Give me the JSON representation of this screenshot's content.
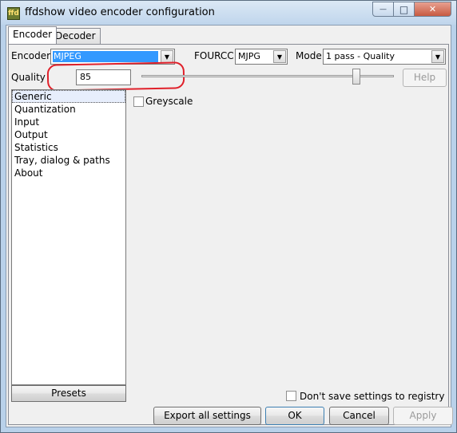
{
  "window": {
    "title": "ffdshow video encoder configuration",
    "icon_text": "ffd",
    "minimize_glyph": "—",
    "maximize_glyph": "□",
    "close_glyph": "✕"
  },
  "tabs": [
    {
      "label": "Encoder",
      "active": true
    },
    {
      "label": "Decoder",
      "active": false
    }
  ],
  "encoder_row": {
    "encoder_label": "Encoder:",
    "encoder_value": "MJPEG",
    "fourcc_label": "FOURCC:",
    "fourcc_value": "MJPG",
    "mode_label": "Mode:",
    "mode_value": "1 pass - Quality"
  },
  "quality_row": {
    "label": "Quality",
    "value": "85",
    "slider_level": 0.85,
    "help_label": "Help"
  },
  "sections": [
    {
      "label": "Generic",
      "selected": true
    },
    {
      "label": "Quantization",
      "selected": false
    },
    {
      "label": "Input",
      "selected": false
    },
    {
      "label": "Output",
      "selected": false
    },
    {
      "label": "Statistics",
      "selected": false
    },
    {
      "label": "Tray, dialog & paths",
      "selected": false
    },
    {
      "label": "About",
      "selected": false
    }
  ],
  "generic_page": {
    "greyscale_label": "Greyscale",
    "greyscale_checked": false
  },
  "presets_label": "Presets",
  "dont_save": {
    "label": "Don't save settings to registry",
    "checked": false
  },
  "footer": {
    "export_label": "Export all settings",
    "ok_label": "OK",
    "cancel_label": "Cancel",
    "apply_label": "Apply"
  },
  "dropdown_arrow_glyph": "▼",
  "colors": {
    "selection": "#3399ff",
    "annotation_ring": "#e0202a"
  }
}
